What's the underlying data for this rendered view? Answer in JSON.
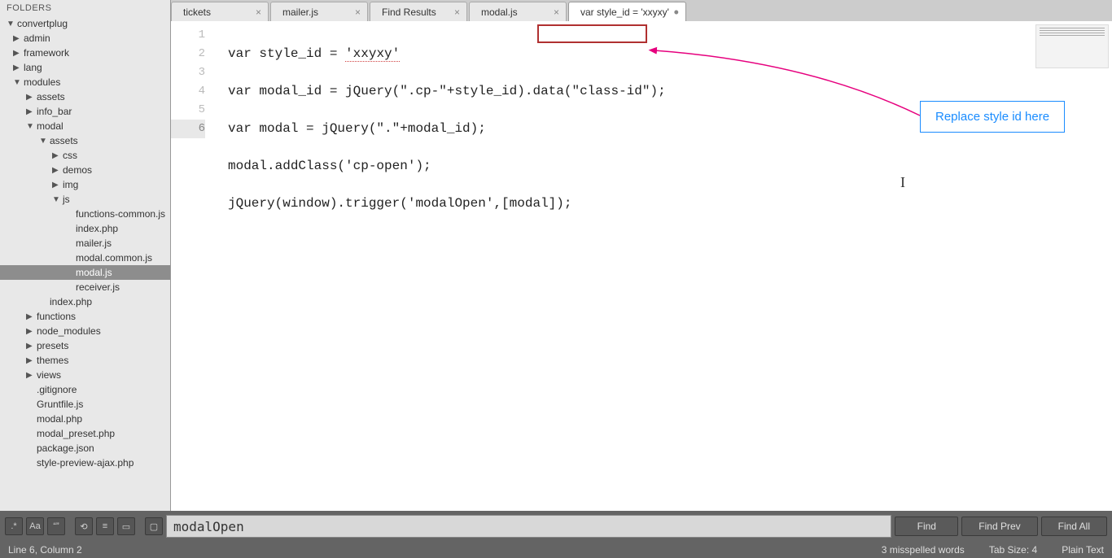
{
  "sidebar": {
    "header": "FOLDERS",
    "items": [
      {
        "label": "convertplug",
        "chev": "open",
        "pad": 0
      },
      {
        "label": "admin",
        "chev": "closed",
        "pad": 1
      },
      {
        "label": "framework",
        "chev": "closed",
        "pad": 1
      },
      {
        "label": "lang",
        "chev": "closed",
        "pad": 1
      },
      {
        "label": "modules",
        "chev": "open",
        "pad": 1
      },
      {
        "label": "assets",
        "chev": "closed",
        "pad": 2
      },
      {
        "label": "info_bar",
        "chev": "closed",
        "pad": 2
      },
      {
        "label": "modal",
        "chev": "open",
        "pad": 2
      },
      {
        "label": "assets",
        "chev": "open",
        "pad": 3
      },
      {
        "label": "css",
        "chev": "closed",
        "pad": 4
      },
      {
        "label": "demos",
        "chev": "closed",
        "pad": 4
      },
      {
        "label": "img",
        "chev": "closed",
        "pad": 4
      },
      {
        "label": "js",
        "chev": "open",
        "pad": 4
      },
      {
        "label": "functions-common.js",
        "chev": "none",
        "pad": 5
      },
      {
        "label": "index.php",
        "chev": "none",
        "pad": 5
      },
      {
        "label": "mailer.js",
        "chev": "none",
        "pad": 5
      },
      {
        "label": "modal.common.js",
        "chev": "none",
        "pad": 5
      },
      {
        "label": "modal.js",
        "chev": "none",
        "pad": 5,
        "selected": true
      },
      {
        "label": "receiver.js",
        "chev": "none",
        "pad": 5
      },
      {
        "label": "index.php",
        "chev": "none",
        "pad": 3
      },
      {
        "label": "functions",
        "chev": "closed",
        "pad": 2
      },
      {
        "label": "node_modules",
        "chev": "closed",
        "pad": 2
      },
      {
        "label": "presets",
        "chev": "closed",
        "pad": 2
      },
      {
        "label": "themes",
        "chev": "closed",
        "pad": 2
      },
      {
        "label": "views",
        "chev": "closed",
        "pad": 2
      },
      {
        "label": ".gitignore",
        "chev": "none",
        "pad": 2
      },
      {
        "label": "Gruntfile.js",
        "chev": "none",
        "pad": 2
      },
      {
        "label": "modal.php",
        "chev": "none",
        "pad": 2
      },
      {
        "label": "modal_preset.php",
        "chev": "none",
        "pad": 2
      },
      {
        "label": "package.json",
        "chev": "none",
        "pad": 2
      },
      {
        "label": "style-preview-ajax.php",
        "chev": "none",
        "pad": 2
      }
    ]
  },
  "tabs": [
    {
      "label": "tickets",
      "close": "×",
      "active": false
    },
    {
      "label": "mailer.js",
      "close": "×",
      "active": false
    },
    {
      "label": "Find Results",
      "close": "×",
      "active": false
    },
    {
      "label": "modal.js",
      "close": "×",
      "active": false
    },
    {
      "label": "var style_id = 'xxyxy'",
      "dirty": "•",
      "active": true
    }
  ],
  "gutter": [
    "1",
    "2",
    "3",
    "4",
    "5",
    "6"
  ],
  "code": {
    "l1a": "var style_id = ",
    "l1b": "'xxyxy'",
    "l2": "var modal_id = jQuery(\".cp-\"+style_id).data(\"class-id\");",
    "l3": "var modal = jQuery(\".\"+modal_id);",
    "l4": "modal.addClass('cp-open');",
    "l5": "jQuery(window).trigger('modalOpen',[modal]);",
    "l6": ""
  },
  "callout": "Replace style id here",
  "findbar": {
    "btn_regex": ".*",
    "btn_case": "Aa",
    "btn_word": "“”",
    "btn_wrap": "⟲",
    "btn_sel": "≡",
    "btn_hl": "▭",
    "btn_ctx": "▢",
    "value": "modalOpen",
    "find": "Find",
    "find_prev": "Find Prev",
    "find_all": "Find All"
  },
  "status": {
    "left": "Line 6, Column 2",
    "spell": "3 misspelled words",
    "tab": "Tab Size: 4",
    "syntax": "Plain Text"
  }
}
